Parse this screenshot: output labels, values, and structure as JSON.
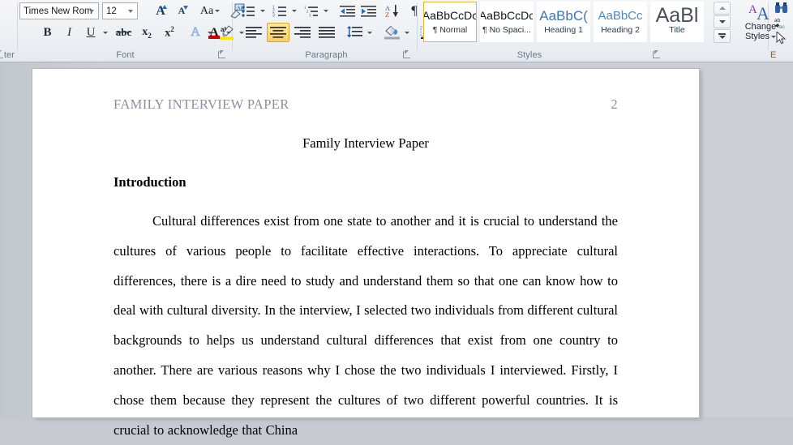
{
  "application": "Microsoft Word",
  "ribbon": {
    "groups": [
      {
        "name": "clipboard",
        "label": "ter",
        "truncated": true
      },
      {
        "name": "font",
        "label": "Font"
      },
      {
        "name": "paragraph",
        "label": "Paragraph"
      },
      {
        "name": "styles",
        "label": "Styles"
      },
      {
        "name": "editing",
        "label": "E",
        "truncated": true
      }
    ],
    "font_group": {
      "font_name": "Times New Rom",
      "font_size": "12",
      "buttons": [
        {
          "name": "grow-font",
          "glyph": "A"
        },
        {
          "name": "shrink-font",
          "glyph": "A"
        },
        {
          "name": "change-case",
          "glyph": "Aa"
        },
        {
          "name": "clear-formatting",
          "glyph": "A"
        },
        {
          "name": "bold",
          "glyph": "B"
        },
        {
          "name": "italic",
          "glyph": "I"
        },
        {
          "name": "underline",
          "glyph": "U"
        },
        {
          "name": "strikethrough",
          "glyph": "abc"
        },
        {
          "name": "subscript",
          "glyph": "x"
        },
        {
          "name": "superscript",
          "glyph": "x"
        },
        {
          "name": "text-effects",
          "glyph": "A"
        },
        {
          "name": "text-highlight-color",
          "glyph": "ab"
        },
        {
          "name": "font-color",
          "glyph": "A"
        }
      ]
    },
    "paragraph_group": {
      "buttons": [
        {
          "name": "bullets"
        },
        {
          "name": "numbering"
        },
        {
          "name": "multilevel-list"
        },
        {
          "name": "decrease-indent"
        },
        {
          "name": "increase-indent"
        },
        {
          "name": "sort"
        },
        {
          "name": "show-formatting-marks",
          "glyph": "¶"
        },
        {
          "name": "align-left"
        },
        {
          "name": "align-center",
          "active": true
        },
        {
          "name": "align-right"
        },
        {
          "name": "justify"
        },
        {
          "name": "line-spacing"
        },
        {
          "name": "shading"
        },
        {
          "name": "borders"
        }
      ]
    },
    "styles_group": {
      "label": "Styles",
      "items": [
        {
          "preview": "AaBbCcDc",
          "name": "¶ Normal",
          "selected": true
        },
        {
          "preview": "AaBbCcDc",
          "name": "¶ No Spaci...",
          "selected": false
        },
        {
          "preview": "AaBbC(",
          "name": "Heading 1",
          "selected": false
        },
        {
          "preview": "AaBbCc",
          "name": "Heading 2",
          "selected": false
        },
        {
          "preview": "AaBl",
          "name": "Title",
          "selected": false
        }
      ],
      "change_styles_line1": "Change",
      "change_styles_line2": "Styles"
    },
    "editing_group": {
      "label": "E",
      "buttons": [
        {
          "name": "find-icon"
        },
        {
          "name": "replace-icon"
        },
        {
          "name": "select-icon"
        }
      ]
    },
    "colors": {
      "style_selected_border": "#e3b53c",
      "active_button": "#fccf5c",
      "heading_blue": "#3d74b8",
      "group_label": "#6d7782"
    }
  },
  "document": {
    "header_text": "FAMILY INTERVIEW PAPER",
    "page_number": "2",
    "title": "Family Interview Paper",
    "section_heading": "Introduction",
    "body_paragraph": "Cultural differences exist from one state to another and it is crucial to understand the cultures of various people to facilitate effective interactions. To appreciate cultural differences, there is a dire need to study and understand them so that one can know how to deal with cultural diversity. In the interview, I selected two individuals from different cultural backgrounds to helps us understand cultural differences that exist from one country to another. There are various reasons why I chose the two individuals I interviewed. Firstly, I chose them because they represent the cultures of two different powerful countries. It is crucial to acknowledge that China",
    "header_color": "#8d8da0",
    "body_color": "#000000"
  }
}
